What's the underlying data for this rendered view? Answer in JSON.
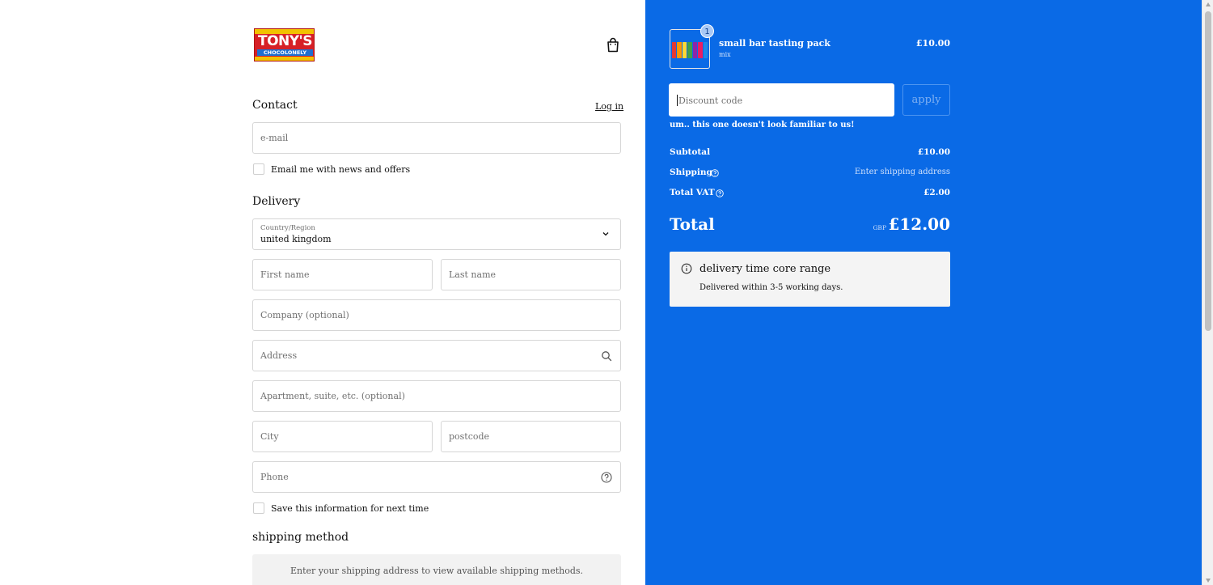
{
  "brand": {
    "logo_word": "TONY'S",
    "logo_sub": "CHOCOLONELY"
  },
  "header": {
    "cart_icon": "shopping-bag-icon"
  },
  "contact": {
    "title": "Contact",
    "login_link": "Log in",
    "email_placeholder": "e-mail",
    "newsletter_label": "Email me with news and offers"
  },
  "delivery": {
    "title": "Delivery",
    "country_label": "Country/Region",
    "country_value": "united kingdom",
    "first_name_placeholder": "First name",
    "last_name_placeholder": "Last name",
    "company_placeholder": "Company (optional)",
    "address_placeholder": "Address",
    "apartment_placeholder": "Apartment, suite, etc. (optional)",
    "city_placeholder": "City",
    "postcode_placeholder": "postcode",
    "phone_placeholder": "Phone",
    "save_info_label": "Save this information for next time"
  },
  "shipping": {
    "title": "shipping method",
    "message": "Enter your shipping address to view available shipping methods."
  },
  "order": {
    "item": {
      "name": "small bar tasting pack",
      "variant": "mix",
      "price": "£10.00",
      "quantity": "1"
    },
    "discount_placeholder": "Discount code",
    "apply_label": "apply",
    "discount_error": "um.. this one doesn't look familiar to us!",
    "subtotal_label": "Subtotal",
    "subtotal_value": "£10.00",
    "shipping_label": "Shipping",
    "shipping_value": "Enter shipping address",
    "vat_label": "Total VAT",
    "vat_value": "£2.00",
    "total_label": "Total",
    "total_currency": "GBP",
    "total_value": "£12.00"
  },
  "delivery_info": {
    "title": "delivery time core range",
    "text": "Delivered within 3-5 working days."
  },
  "colors": {
    "accent_blue": "#0a6ae6",
    "logo_red": "#d62026",
    "logo_yellow": "#f2c200"
  }
}
